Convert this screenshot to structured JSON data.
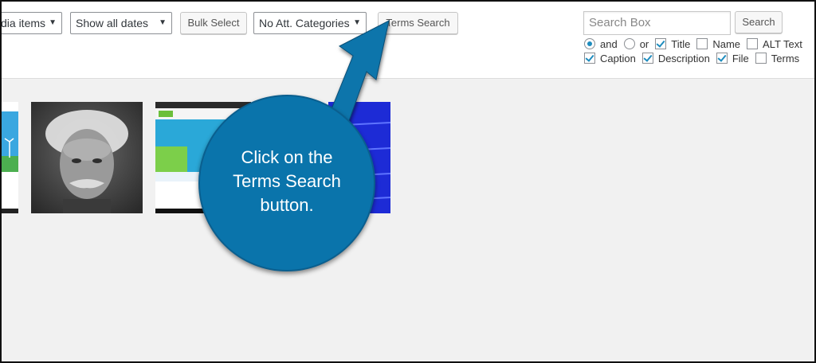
{
  "toolbar": {
    "media_type_select": "dia items",
    "dates_select": "Show all dates",
    "bulk_select_label": "Bulk Select",
    "categories_select": "No Att. Categories",
    "terms_search_label": "Terms Search"
  },
  "search": {
    "placeholder": "Search Box",
    "button_label": "Search",
    "options_row1": {
      "and_label": "and",
      "or_label": "or",
      "title_label": "Title",
      "name_label": "Name",
      "alt_text_label": "ALT Text"
    },
    "options_row2": {
      "caption_label": "Caption",
      "description_label": "Description",
      "file_label": "File",
      "terms_label": "Terms"
    },
    "state": {
      "and": true,
      "or": false,
      "title": true,
      "name": false,
      "alt_text": false,
      "caption": true,
      "description": true,
      "file": true,
      "terms": false
    }
  },
  "callout": {
    "line1": "Click on the",
    "line2": "Terms Search",
    "line3": "button."
  },
  "colors": {
    "callout": "#0a74ab",
    "accent": "#1e8cbe",
    "background": "#f1f1f1"
  },
  "icons": [
    "chevron-down-icon",
    "arrow-pointer-icon",
    "checkbox-check-icon"
  ]
}
